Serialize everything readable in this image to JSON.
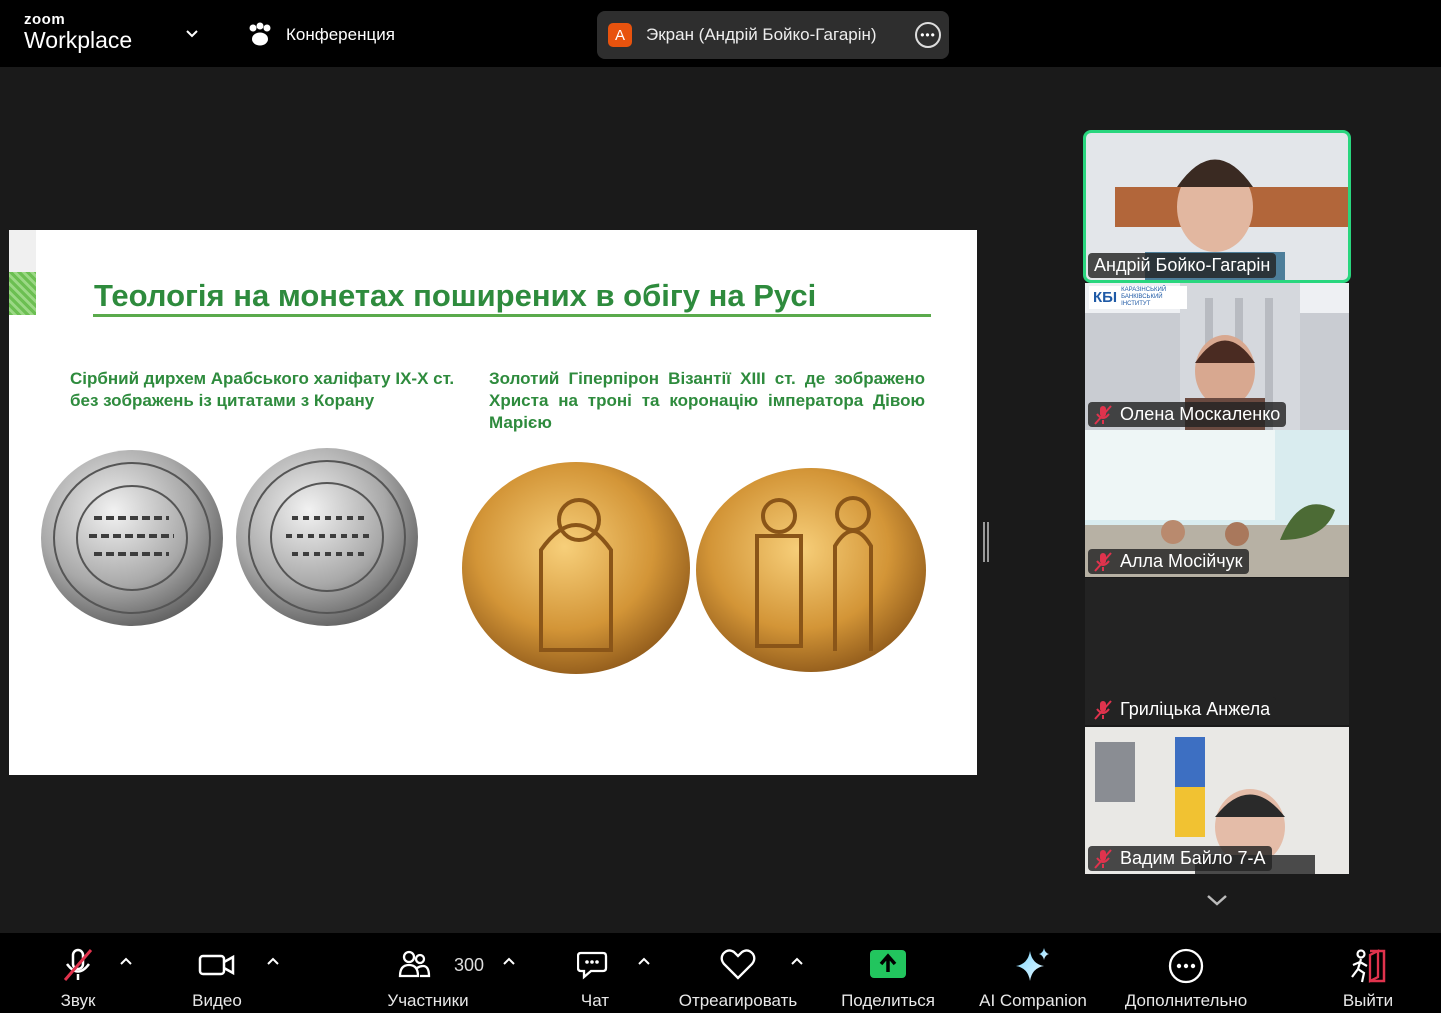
{
  "app": {
    "brand_small": "zoom",
    "brand_big": "Workplace"
  },
  "header": {
    "meeting_label": "Конференция",
    "screen_share": {
      "avatar_letter": "A",
      "title": "Экран (Андрій Бойко-Гагарін)"
    }
  },
  "slide": {
    "title": "Теологія на монетах поширених в обігу на Русі",
    "caption_left": "Сірбний дирхем Арабського халіфату IX-X ст. без зображень із цитатами з Корану",
    "caption_right": "Золотий Гіперпірон Візантії XIII ст. де зображено Христа на троні та коронацію імператора Дівою Марією"
  },
  "participants": [
    {
      "name": "Андрій Бойко-Гагарін",
      "muted": false,
      "active": true
    },
    {
      "name": "Олена Москаленко",
      "muted": true,
      "logo_text": "КБІ",
      "logo_sub": "КАРАЗІНСЬКИЙ БАНКІВСЬКИЙ ІНСТИТУТ"
    },
    {
      "name": "Алла Мосійчук",
      "muted": true
    },
    {
      "name": "Гриліцька Анжела",
      "muted": true
    },
    {
      "name": "Вадим Байло 7-А",
      "muted": true
    }
  ],
  "toolbar": {
    "audio": "Звук",
    "video": "Видео",
    "participants": "Участники",
    "participants_count": "300",
    "chat": "Чат",
    "react": "Отреагировать",
    "share": "Поделиться",
    "ai": "AI Companion",
    "more": "Дополнительно",
    "leave": "Выйти"
  },
  "colors": {
    "active_border": "#29d67e",
    "share_green": "#22c55e",
    "slide_green": "#2e8b3d",
    "leave_red": "#e0334d"
  }
}
